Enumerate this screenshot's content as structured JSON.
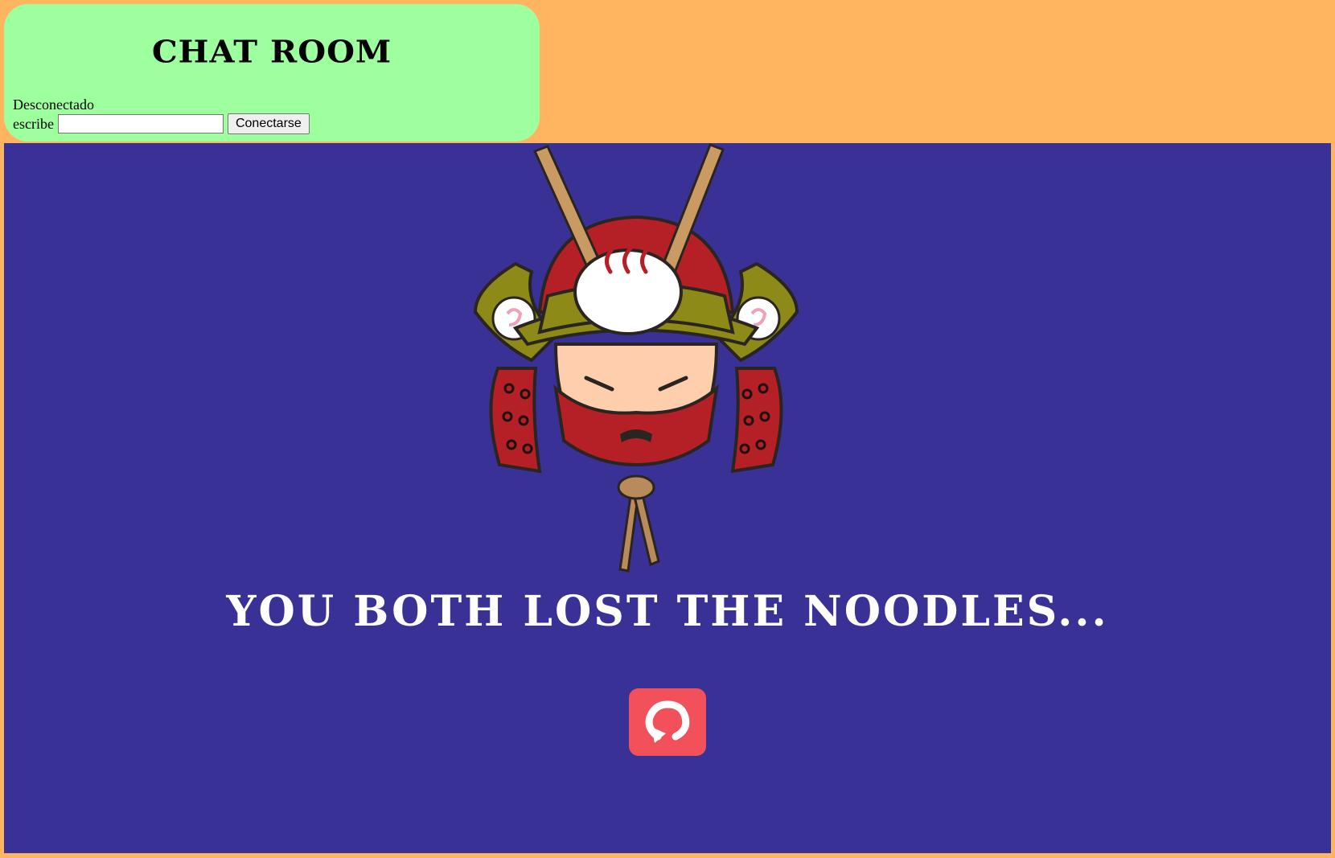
{
  "chat": {
    "title": "CHAT ROOM",
    "status": "Desconectado",
    "compose_label": "escribe",
    "message_value": "",
    "connect_label": "Conectarse"
  },
  "game": {
    "result_message": "YOU BOTH LOST THE NOODLES...",
    "background_color": "#3A3197",
    "restart_icon": "restart-icon",
    "samurai_icon": "samurai-noodle-mascot"
  },
  "colors": {
    "page_background": "#FFB560",
    "chat_panel": "#9EFF9E",
    "restart_button": "#F2505A"
  }
}
